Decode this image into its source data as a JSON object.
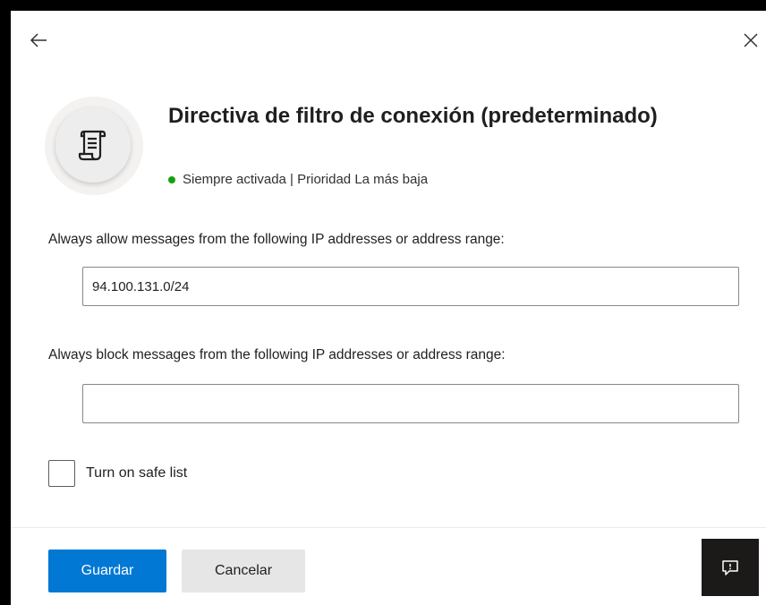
{
  "header": {
    "title": "Directiva de filtro de conexión (predeterminado)",
    "status_text": "Siempre activada | Prioridad La más baja",
    "status_color": "#13a10e",
    "icon": "policy-scroll-icon"
  },
  "form": {
    "allow_label": "Always allow messages from the following IP addresses or address range:",
    "allow_value": "94.100.131.0/24",
    "block_label": "Always block messages from the following IP addresses or address range:",
    "block_value": "",
    "safe_list_label": "Turn on safe list",
    "safe_list_checked": false
  },
  "footer": {
    "save_label": "Guardar",
    "cancel_label": "Cancelar"
  },
  "colors": {
    "primary": "#0078d4",
    "background": "#ffffff",
    "frame": "#000000"
  }
}
